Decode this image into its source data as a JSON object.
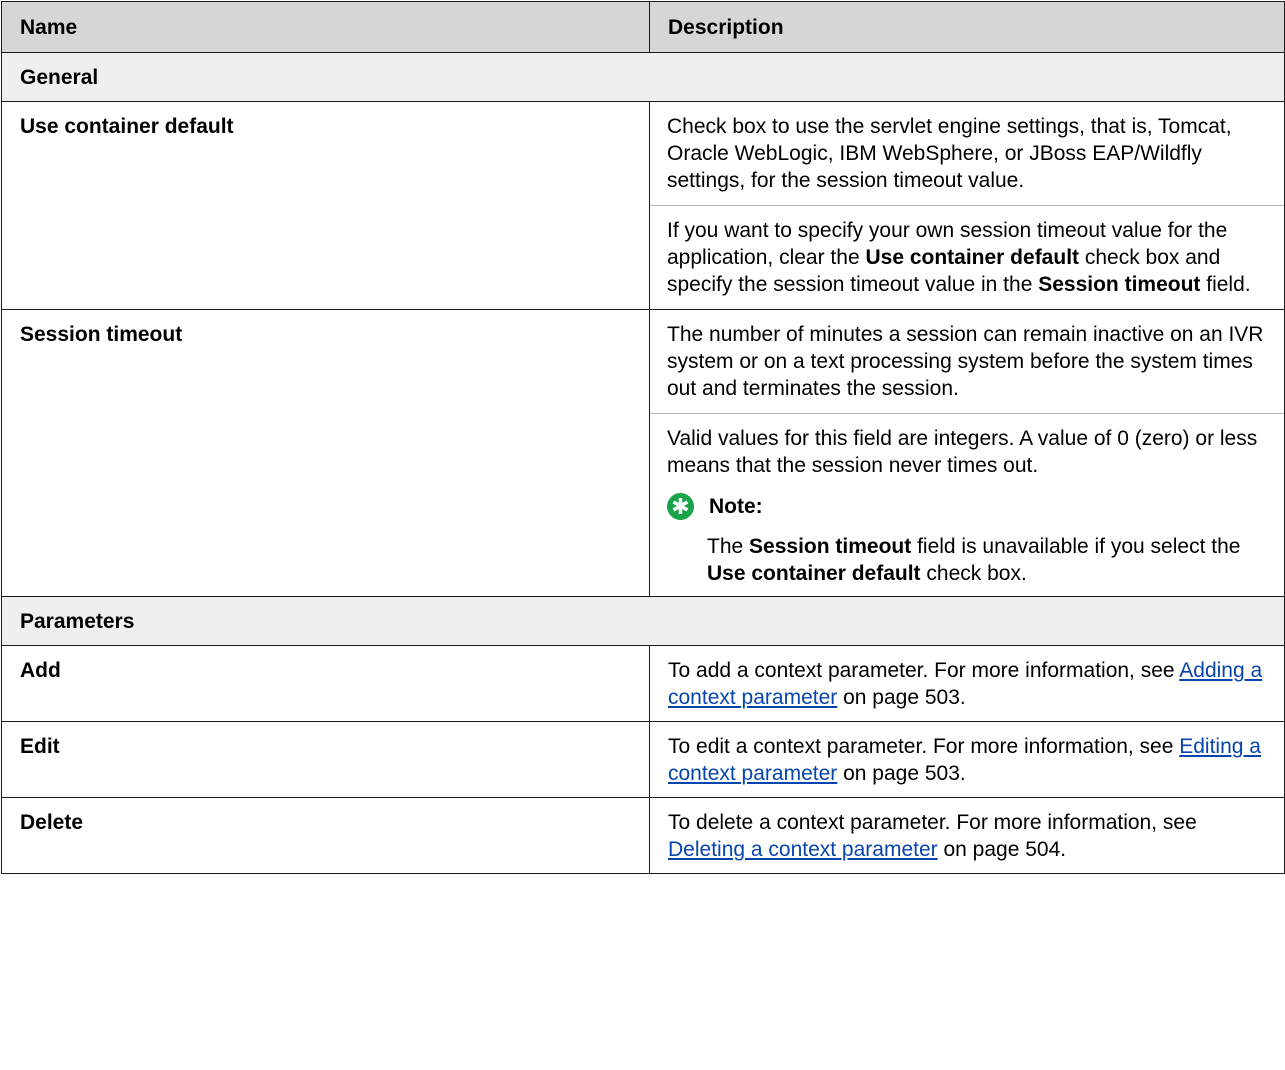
{
  "table": {
    "headers": {
      "name": "Name",
      "description": "Description"
    },
    "sections": {
      "general": "General",
      "parameters": "Parameters"
    },
    "rows": {
      "use_container_default": {
        "name": "Use container default",
        "p1": "Check box to use the servlet engine settings, that is, Tomcat, Oracle WebLogic, IBM WebSphere, or JBoss EAP/Wildfly settings, for the session timeout value.",
        "p2": {
          "a": "If you want to specify your own session timeout value for the application, clear the ",
          "b": "Use container default",
          "c": " check box and specify the session timeout value in the ",
          "d": "Session timeout",
          "e": " field."
        }
      },
      "session_timeout": {
        "name": "Session timeout",
        "p1": "The number of minutes a session can remain inactive on an IVR system or on a text processing system before the system times out and terminates the session.",
        "p2": "Valid values for this field are integers. A value of 0 (zero) or less means that the session never times out.",
        "note": {
          "icon": "star-note-icon",
          "heading": "Note:",
          "a": "The ",
          "b": "Session timeout",
          "c": " field is unavailable if you select the ",
          "d": "Use container default",
          "e": " check box."
        }
      },
      "add": {
        "name": "Add",
        "text": "To add a context parameter. For more information, see ",
        "link": "Adding a context parameter",
        "suffix": " on page 503."
      },
      "edit": {
        "name": "Edit",
        "text": "To edit a context parameter. For more information, see ",
        "link": "Editing a context parameter",
        "suffix": " on page 503."
      },
      "delete": {
        "name": "Delete",
        "text": "To delete a context parameter. For more information, see ",
        "link": "Deleting a context parameter",
        "suffix": " on page 504."
      }
    }
  },
  "colors": {
    "header_bg": "#d6d6d6",
    "section_bg": "#efefef",
    "note_icon": "#1aa34a",
    "link": "#0645ad"
  }
}
